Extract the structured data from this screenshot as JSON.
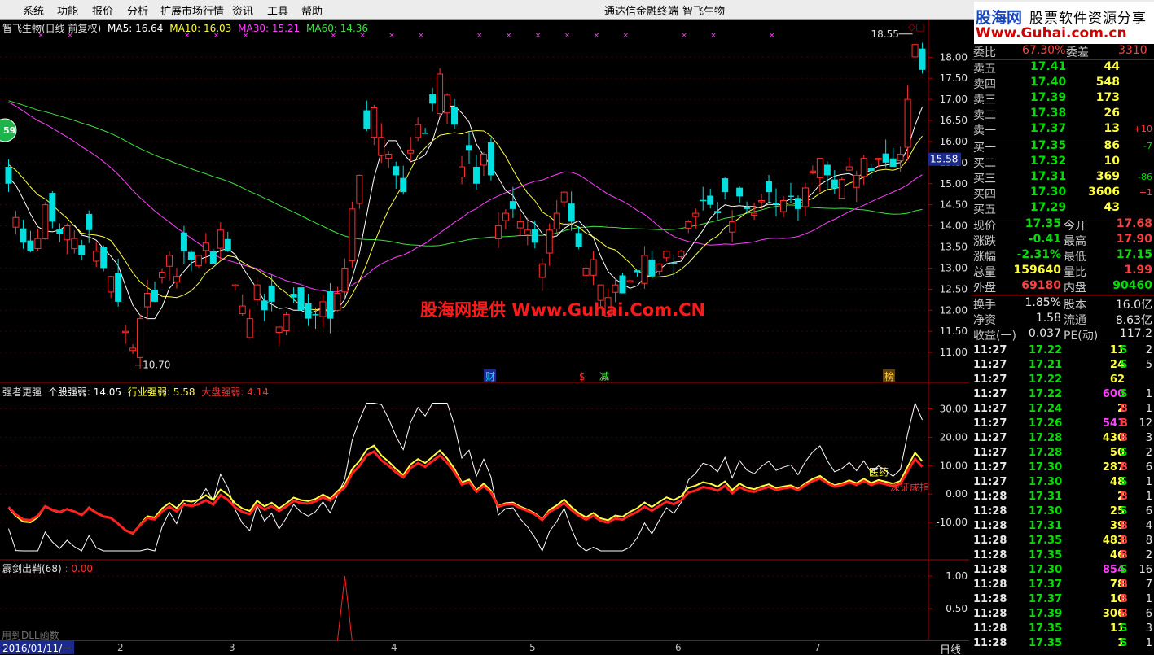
{
  "menu": [
    "系统",
    "功能",
    "报价",
    "分析",
    "扩展市场行情",
    "资讯",
    "工具",
    "帮助"
  ],
  "app_title": "通达信金融终端",
  "stock_title": "智飞生物",
  "logo": {
    "part1": "股海网",
    "part2": "股票软件资源分享",
    "url": "Www.Guhai.com.cn"
  },
  "window_controls": "◇□",
  "watermark": "股海网提供 Www.Guhai.Com.CN",
  "main_chart": {
    "header": "智飞生物(日线 前复权)",
    "ma5": "MA5: 16.64",
    "ma10": "MA10: 16.03",
    "ma30": "MA30: 15.21",
    "ma60": "MA60: 14.36",
    "high_mark": "18.55",
    "low_mark": "10.70",
    "left_badge": "59",
    "current_price_tag": "15.58",
    "events": [
      {
        "label": "财"
      },
      {
        "label": "$"
      },
      {
        "label": "减"
      },
      {
        "label": "榜"
      }
    ],
    "colors": {
      "up": "#ff3030",
      "down": "#00e0e0",
      "ma5": "#ffffff",
      "ma10": "#ffff40",
      "ma30": "#ff40ff",
      "ma60": "#40e040"
    }
  },
  "chart_data": [
    {
      "type": "candlestick",
      "title": "智飞生物(日线 前复权)",
      "y_ticks": [
        18.0,
        17.5,
        17.0,
        16.5,
        16.0,
        15.5,
        15.0,
        14.5,
        14.0,
        13.5,
        13.0,
        12.5,
        12.0,
        11.5,
        11.0
      ],
      "ylim": [
        10.5,
        18.7
      ],
      "x_ticks": [
        "2016/01/11/一",
        "2",
        "3",
        "4",
        "5",
        "6",
        "7"
      ],
      "high": 18.55,
      "low": 10.7,
      "closes": [
        15.0,
        14.2,
        13.6,
        13.4,
        13.7,
        14.5,
        14.1,
        13.8,
        14.0,
        13.7,
        13.3,
        13.9,
        13.4,
        13.0,
        12.8,
        12.2,
        11.5,
        11.1,
        11.8,
        12.4,
        12.2,
        12.9,
        13.3,
        12.8,
        13.4,
        13.2,
        13.3,
        13.6,
        13.1,
        13.9,
        13.4,
        12.6,
        12.1,
        11.8,
        12.6,
        12.0,
        12.2,
        11.6,
        11.9,
        12.3,
        12.0,
        11.8,
        11.9,
        12.2,
        11.8,
        12.4,
        13.0,
        14.4,
        15.2,
        16.3,
        16.8,
        16.1,
        15.7,
        15.2,
        14.8,
        15.8,
        16.4,
        16.2,
        16.9,
        17.6,
        17.1,
        16.4,
        15.4,
        15.8,
        15.0,
        15.7,
        15.2,
        14.0,
        14.3,
        14.4,
        14.1,
        13.9,
        13.6,
        13.1,
        13.9,
        14.3,
        14.8,
        14.1,
        13.5,
        13.0,
        13.2,
        12.6,
        12.3,
        12.6,
        12.4,
        12.7,
        12.9,
        13.3,
        12.8,
        13.1,
        13.4,
        13.1,
        13.4,
        14.1,
        14.3,
        14.6,
        14.5,
        14.3,
        14.8,
        14.1,
        14.7,
        14.4,
        14.3,
        14.6,
        14.8,
        14.5,
        14.6,
        14.7,
        14.4,
        14.9,
        15.3,
        15.6,
        15.2,
        14.9,
        15.1,
        15.4,
        15.2,
        15.6,
        15.3,
        15.6,
        15.5,
        15.4,
        15.7,
        17.0,
        18.3,
        17.7
      ],
      "ma": {
        "ma5": 16.64,
        "ma10": 16.03,
        "ma30": 15.21,
        "ma60": 14.36
      }
    },
    {
      "type": "line",
      "title": "强者更强",
      "series": [
        {
          "name": "个股强弱",
          "last": 14.05
        },
        {
          "name": "行业强弱",
          "last": 5.58
        },
        {
          "name": "大盘强弱",
          "last": 4.14
        }
      ],
      "y_ticks": [
        30.0,
        20.0,
        10.0,
        0.0,
        -10.0
      ],
      "ylim": [
        -20,
        33
      ],
      "labels": [
        "医药",
        "深证成指"
      ]
    },
    {
      "type": "line",
      "title": "霹剑出鞘(68)",
      "value": 0.0,
      "y_ticks": [
        1.0,
        0.5
      ],
      "ylim": [
        0,
        1.1
      ]
    }
  ],
  "sub1": {
    "title": "强者更强",
    "s1": "个股强弱: 14.05",
    "s2": "行业强弱: 5.58",
    "s3": "大盘强弱: 4.14",
    "tag1": "医药",
    "tag2": "深证成指"
  },
  "sub2": {
    "title": "霹剑出鞘(68)",
    "value": ": 0.00"
  },
  "dll_hint": "用到DLL函数",
  "date_box": "2016/01/11/一",
  "months": [
    "2",
    "3",
    "4",
    "5",
    "6",
    "7"
  ],
  "period": "日线",
  "panel": {
    "webi": {
      "l": "委比",
      "v": "67.30%",
      "l2": "委差",
      "v2": "3310"
    },
    "sells": [
      {
        "l": "卖五",
        "p": "17.41",
        "q": "44"
      },
      {
        "l": "卖四",
        "p": "17.40",
        "q": "548"
      },
      {
        "l": "卖三",
        "p": "17.39",
        "q": "173"
      },
      {
        "l": "卖二",
        "p": "17.38",
        "q": "26"
      },
      {
        "l": "卖一",
        "p": "17.37",
        "q": "13",
        "d": "+10"
      }
    ],
    "buys": [
      {
        "l": "买一",
        "p": "17.35",
        "q": "86",
        "d": "-7"
      },
      {
        "l": "买二",
        "p": "17.32",
        "q": "10",
        "d": ""
      },
      {
        "l": "买三",
        "p": "17.31",
        "q": "369",
        "d": "-86"
      },
      {
        "l": "买四",
        "p": "17.30",
        "q": "3606",
        "d": "+1"
      },
      {
        "l": "买五",
        "p": "17.29",
        "q": "43",
        "d": ""
      }
    ],
    "quote": [
      {
        "l": "现价",
        "v": "17.35",
        "vc": "dn",
        "l2": "今开",
        "v2": "17.68",
        "v2c": "up"
      },
      {
        "l": "涨跌",
        "v": "-0.41",
        "vc": "dn",
        "l2": "最高",
        "v2": "17.90",
        "v2c": "up"
      },
      {
        "l": "涨幅",
        "v": "-2.31%",
        "vc": "dn",
        "l2": "最低",
        "v2": "17.15",
        "v2c": "dn"
      },
      {
        "l": "总量",
        "v": "159640",
        "vc": "yl",
        "l2": "量比",
        "v2": "1.99",
        "v2c": "up"
      },
      {
        "l": "外盘",
        "v": "69180",
        "vc": "up",
        "l2": "内盘",
        "v2": "90460",
        "v2c": "dn"
      }
    ],
    "fin": [
      {
        "l": "换手",
        "v": "1.85%",
        "l2": "股本",
        "v2": "16.0亿"
      },
      {
        "l": "净资",
        "v": "1.58",
        "l2": "流通",
        "v2": "8.63亿"
      },
      {
        "l": "收益(一)",
        "v": "0.037",
        "l2": "PE(动)",
        "v2": "117.2"
      }
    ],
    "ticks": [
      {
        "t": "11:27",
        "p": "17.22",
        "v": "11",
        "s": "S",
        "n": "2"
      },
      {
        "t": "11:27",
        "p": "17.21",
        "v": "24",
        "s": "S",
        "n": "5"
      },
      {
        "t": "11:27",
        "p": "17.22",
        "v": "62",
        "s": "",
        "n": ""
      },
      {
        "t": "11:27",
        "p": "17.22",
        "v": "600",
        "s": "S",
        "n": "1"
      },
      {
        "t": "11:27",
        "p": "17.24",
        "v": "2",
        "s": "B",
        "n": "1"
      },
      {
        "t": "11:27",
        "p": "17.26",
        "v": "541",
        "s": "B",
        "n": "12"
      },
      {
        "t": "11:27",
        "p": "17.28",
        "v": "430",
        "s": "B",
        "n": "3"
      },
      {
        "t": "11:27",
        "p": "17.28",
        "v": "50",
        "s": "S",
        "n": "2"
      },
      {
        "t": "11:27",
        "p": "17.30",
        "v": "287",
        "s": "B",
        "n": "6"
      },
      {
        "t": "11:27",
        "p": "17.30",
        "v": "48",
        "s": "S",
        "n": "1"
      },
      {
        "t": "11:28",
        "p": "17.31",
        "v": "2",
        "s": "B",
        "n": "1"
      },
      {
        "t": "11:28",
        "p": "17.30",
        "v": "25",
        "s": "S",
        "n": "6"
      },
      {
        "t": "11:28",
        "p": "17.31",
        "v": "39",
        "s": "B",
        "n": "4"
      },
      {
        "t": "11:28",
        "p": "17.35",
        "v": "483",
        "s": "B",
        "n": "8"
      },
      {
        "t": "11:28",
        "p": "17.35",
        "v": "46",
        "s": "B",
        "n": "2"
      },
      {
        "t": "11:28",
        "p": "17.30",
        "v": "854",
        "s": "S",
        "n": "16"
      },
      {
        "t": "11:28",
        "p": "17.37",
        "v": "78",
        "s": "B",
        "n": "7"
      },
      {
        "t": "11:28",
        "p": "17.37",
        "v": "10",
        "s": "B",
        "n": "1"
      },
      {
        "t": "11:28",
        "p": "17.39",
        "v": "306",
        "s": "B",
        "n": "6"
      },
      {
        "t": "11:28",
        "p": "17.35",
        "v": "11",
        "s": "S",
        "n": "3"
      },
      {
        "t": "11:28",
        "p": "17.35",
        "v": "1",
        "s": "S",
        "n": "1"
      }
    ]
  }
}
